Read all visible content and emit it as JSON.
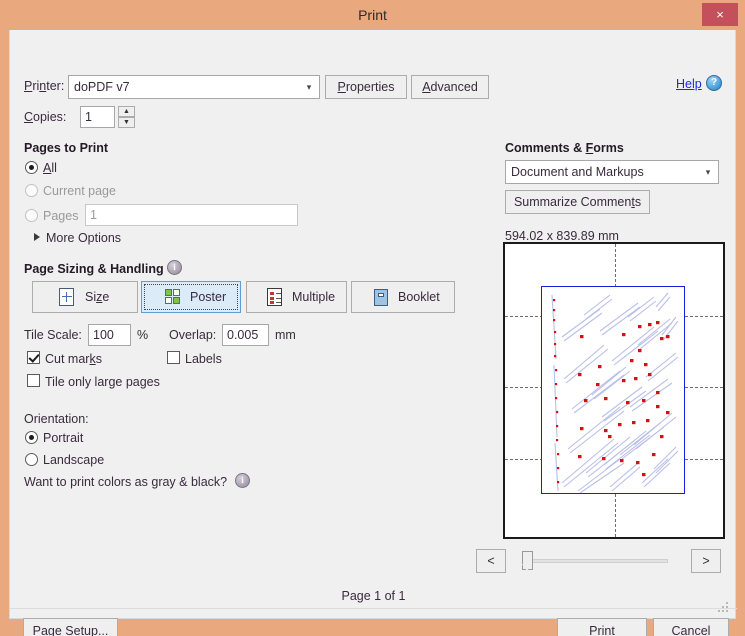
{
  "window": {
    "title": "Print",
    "close_label": "×"
  },
  "printer": {
    "label": "Printer:",
    "value": "doPDF v7",
    "properties_label": "Properties",
    "advanced_label": "Advanced",
    "help_label": "Help",
    "help_icon": "?"
  },
  "copies": {
    "label": "Copies:",
    "value": "1",
    "up_glyph": "▲",
    "down_glyph": "▼"
  },
  "pages_to_print": {
    "heading": "Pages to Print",
    "options": [
      {
        "label": "All",
        "selected": true,
        "disabled": false
      },
      {
        "label": "Current page",
        "selected": false,
        "disabled": true
      },
      {
        "label": "Pages",
        "selected": false,
        "disabled": true
      }
    ],
    "pages_value": "1",
    "more_options_label": "More Options"
  },
  "page_sizing": {
    "heading": "Page Sizing & Handling",
    "info_icon": "i",
    "modes": [
      {
        "label": "Size",
        "icon": "size-icon",
        "selected": false
      },
      {
        "label": "Poster",
        "icon": "poster-icon",
        "selected": true
      },
      {
        "label": "Multiple",
        "icon": "multiple-icon",
        "selected": false
      },
      {
        "label": "Booklet",
        "icon": "booklet-icon",
        "selected": false
      }
    ],
    "tile_scale_label": "Tile Scale:",
    "tile_scale_value": "100",
    "tile_scale_unit": "%",
    "overlap_label": "Overlap:",
    "overlap_value": "0.005",
    "overlap_unit": "mm",
    "cut_marks_label": "Cut marks",
    "cut_marks_checked": true,
    "labels_label": "Labels",
    "labels_checked": false,
    "tile_only_large_label": "Tile only large pages",
    "tile_only_large_checked": false
  },
  "orientation": {
    "heading": "Orientation:",
    "options": [
      {
        "label": "Portrait",
        "selected": true
      },
      {
        "label": "Landscape",
        "selected": false
      }
    ]
  },
  "gray_black": {
    "question": "Want to print colors as gray & black?",
    "info_icon": "i"
  },
  "comments_forms": {
    "heading": "Comments & Forms",
    "value": "Document and Markups",
    "summarize_label": "Summarize Comments"
  },
  "preview": {
    "page_dimensions": "594.02 x 839.89 mm",
    "page_indicator": "Page 1 of 1",
    "prev_label": "<",
    "next_label": ">"
  },
  "footer": {
    "page_setup_label": "Page Setup...",
    "print_label": "Print",
    "cancel_label": "Cancel"
  },
  "colors": {
    "frame": "#eaa87e",
    "close_button": "#c3505a",
    "dialog_background": "#f0f0f0",
    "selected_mode": "#dcebf8",
    "selected_mode_border": "#5d9fd4",
    "help_link": "#1d2bd4",
    "text": "#3a2a3d",
    "content_border": "#1c1ce0",
    "plot_line": "#b9bfe8",
    "plot_marker": "#d61010"
  }
}
